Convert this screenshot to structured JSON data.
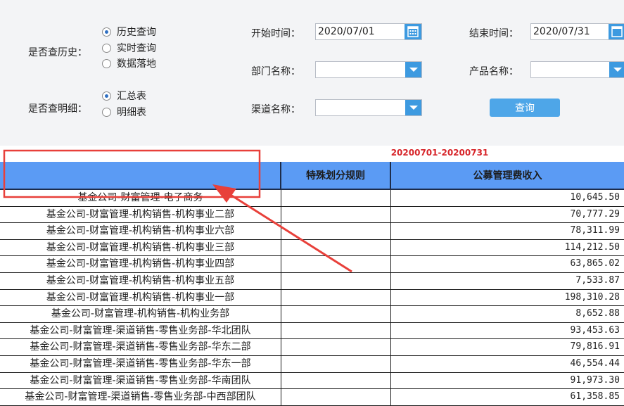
{
  "filters": {
    "history_label": "是否查历史：",
    "history_options": [
      "历史查询",
      "实时查询",
      "数据落地"
    ],
    "detail_label": "是否查明细：",
    "detail_options": [
      "汇总表",
      "明细表"
    ],
    "start_label": "开始时间：",
    "start_value": "2020/07/01",
    "end_label": "结束时间：",
    "end_value": "2020/07/31",
    "dept_label": "部门名称：",
    "product_label": "产品名称：",
    "channel_label": "渠道名称：",
    "query_button": "查询"
  },
  "report": {
    "title": "20200701-20200731",
    "columns": [
      "",
      "特殊划分规则",
      "公募管理费收入"
    ],
    "rows": [
      {
        "name": "基金公司-财富管理-电子商务",
        "rule": "",
        "amount": "10,645.50"
      },
      {
        "name": "基金公司-财富管理-机构销售-机构事业二部",
        "rule": "",
        "amount": "70,777.29"
      },
      {
        "name": "基金公司-财富管理-机构销售-机构事业六部",
        "rule": "",
        "amount": "78,311.99"
      },
      {
        "name": "基金公司-财富管理-机构销售-机构事业三部",
        "rule": "",
        "amount": "114,212.50"
      },
      {
        "name": "基金公司-财富管理-机构销售-机构事业四部",
        "rule": "",
        "amount": "63,865.02"
      },
      {
        "name": "基金公司-财富管理-机构销售-机构事业五部",
        "rule": "",
        "amount": "7,533.87"
      },
      {
        "name": "基金公司-财富管理-机构销售-机构事业一部",
        "rule": "",
        "amount": "198,310.28"
      },
      {
        "name": "基金公司-财富管理-机构销售-机构业务部",
        "rule": "",
        "amount": "8,652.88"
      },
      {
        "name": "基金公司-财富管理-渠道销售-零售业务部-华北团队",
        "rule": "",
        "amount": "93,453.63"
      },
      {
        "name": "基金公司-财富管理-渠道销售-零售业务部-华东二部",
        "rule": "",
        "amount": "79,816.91"
      },
      {
        "name": "基金公司-财富管理-渠道销售-零售业务部-华东一部",
        "rule": "",
        "amount": "46,554.44"
      },
      {
        "name": "基金公司-财富管理-渠道销售-零售业务部-华南团队",
        "rule": "",
        "amount": "91,973.30"
      },
      {
        "name": "基金公司-财富管理-渠道销售-零售业务部-中西部团队",
        "rule": "",
        "amount": "61,358.85"
      }
    ]
  },
  "colors": {
    "header_bg": "#5b9bf4",
    "accent": "#3d9ae0",
    "annotation": "#e8403a",
    "title": "#d7252a"
  }
}
